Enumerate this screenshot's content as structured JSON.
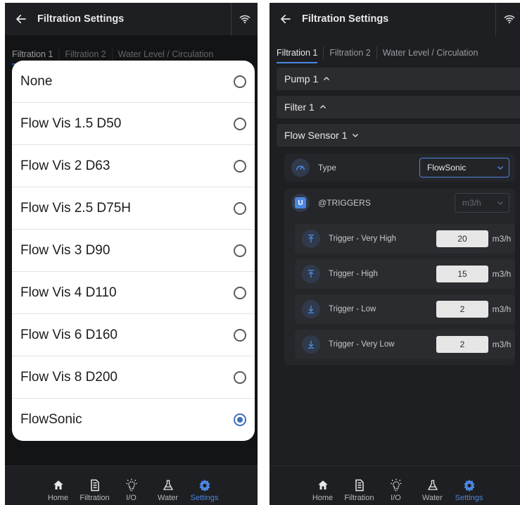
{
  "colors": {
    "background": "#1e1f22",
    "accent": "#4b86e0",
    "sheet": "#ffffff"
  },
  "header": {
    "title": "Filtration Settings",
    "back_icon": "arrow-left-icon",
    "status_icon": "wifi-icon"
  },
  "tabs": [
    {
      "label": "Filtration 1",
      "active": true
    },
    {
      "label": "Filtration 2",
      "active": false
    },
    {
      "label": "Water Level / Circulation",
      "active": false
    }
  ],
  "type_picker": {
    "selected": "FlowSonic",
    "options": [
      {
        "label": "None",
        "checked": false
      },
      {
        "label": "Flow Vis 1.5 D50",
        "checked": false
      },
      {
        "label": "Flow Vis 2 D63",
        "checked": false
      },
      {
        "label": "Flow Vis 2.5 D75H",
        "checked": false
      },
      {
        "label": "Flow Vis 3 D90",
        "checked": false
      },
      {
        "label": "Flow Vis 4 D110",
        "checked": false
      },
      {
        "label": "Flow Vis 6 D160",
        "checked": false
      },
      {
        "label": "Flow Vis 8 D200",
        "checked": false
      },
      {
        "label": "FlowSonic",
        "checked": true
      }
    ]
  },
  "sections": {
    "pump": {
      "label": "Pump 1",
      "expanded": false
    },
    "filter": {
      "label": "Filter 1",
      "expanded": false
    },
    "flow_sensor": {
      "label": "Flow Sensor 1",
      "expanded": true
    }
  },
  "sensor": {
    "type_label": "Type",
    "type_value": "FlowSonic",
    "triggers_badge": "U",
    "triggers_label": "@TRIGGERS",
    "triggers_unit": "m3/h"
  },
  "triggers": [
    {
      "label": "Trigger - Very High",
      "value": "20",
      "unit": "m3/h",
      "icon": "arrow-up-to-line-icon"
    },
    {
      "label": "Trigger - High",
      "value": "15",
      "unit": "m3/h",
      "icon": "arrow-up-to-line-icon"
    },
    {
      "label": "Trigger - Low",
      "value": "2",
      "unit": "m3/h",
      "icon": "arrow-down-to-line-icon"
    },
    {
      "label": "Trigger - Very Low",
      "value": "2",
      "unit": "m3/h",
      "icon": "arrow-down-to-line-icon"
    }
  ],
  "nav": [
    {
      "label": "Home",
      "icon": "home-icon",
      "active": false
    },
    {
      "label": "Filtration",
      "icon": "filtration-icon",
      "active": false
    },
    {
      "label": "I/O",
      "icon": "lightbulb-icon",
      "active": false
    },
    {
      "label": "Water",
      "icon": "flask-icon",
      "active": false
    },
    {
      "label": "Settings",
      "icon": "gear-icon",
      "active": true
    }
  ]
}
